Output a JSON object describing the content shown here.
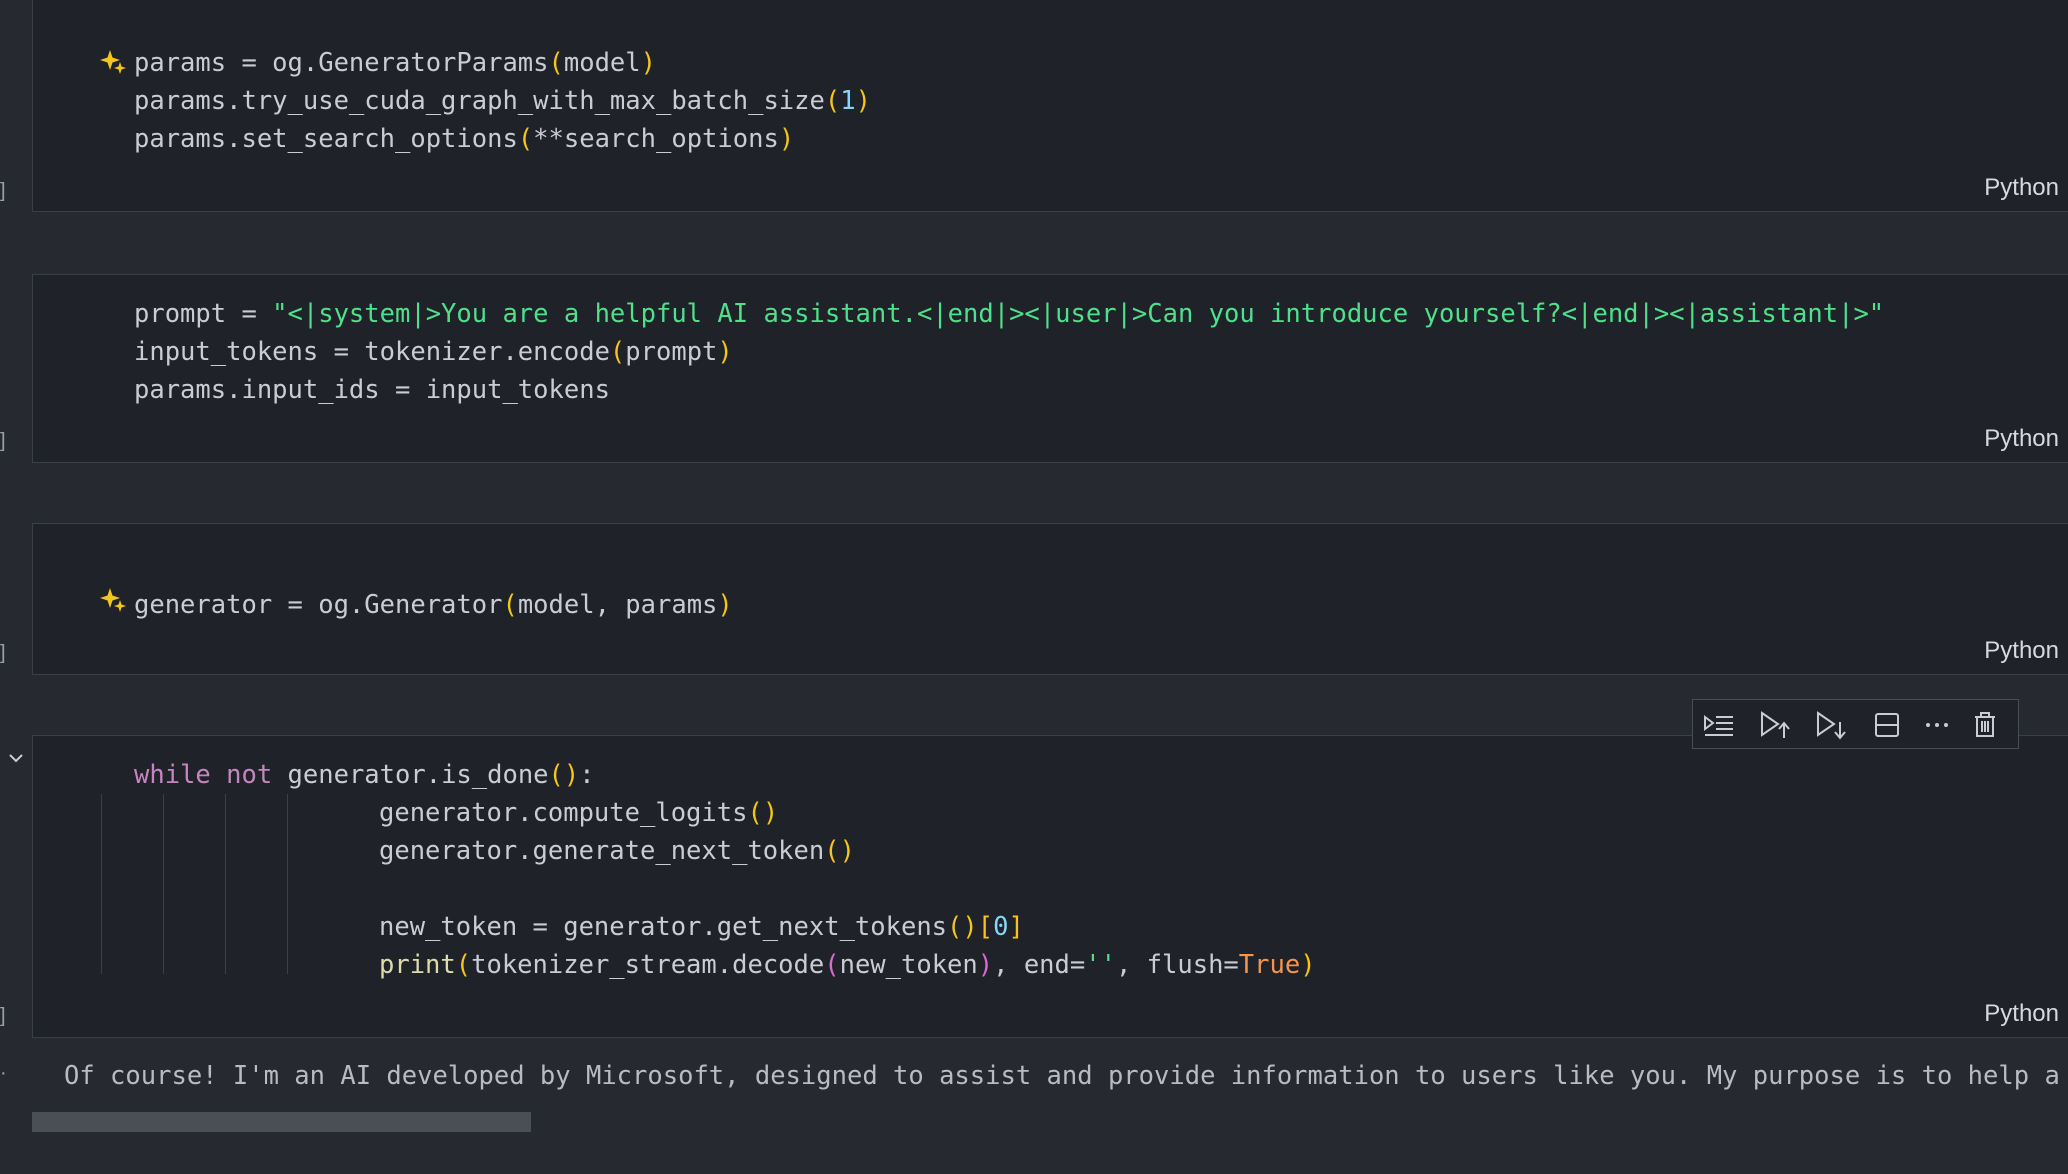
{
  "cells": [
    {
      "language": "Python",
      "lines": [
        "params = og.GeneratorParams(model)",
        "params.try_use_cuda_graph_with_max_batch_size(1)",
        "params.set_search_options(**search_options)"
      ]
    },
    {
      "language": "Python",
      "lines": [
        "prompt = \"<|system|>You are a helpful AI assistant.<|end|><|user|>Can you introduce yourself?<|end|><|assistant|>\"",
        "input_tokens = tokenizer.encode(prompt)",
        "params.input_ids = input_tokens"
      ]
    },
    {
      "language": "Python",
      "lines": [
        "generator = og.Generator(model, params)"
      ]
    },
    {
      "language": "Python",
      "lines": [
        "while not generator.is_done():",
        "generator.compute_logits()",
        "generator.generate_next_token()",
        "",
        "new_token = generator.get_next_tokens()[0]",
        "print(tokenizer_stream.decode(new_token), end='', flush=True)"
      ]
    }
  ],
  "output": {
    "text": "Of course! I'm an AI developed by Microsoft, designed to assist and provide information to users like you. My purpose is to help a"
  },
  "cell_toolbar": {
    "buttons": [
      "run-by-line-icon",
      "execute-above-icon",
      "execute-below-icon",
      "split-cell-icon",
      "more-actions-icon",
      "delete-cell-icon"
    ]
  },
  "colors": {
    "background": "#262a30",
    "cell_background": "#1f2228",
    "string": "#4ee08a",
    "keyword": "#c586c0",
    "bracket": "#f5c518",
    "number": "#86d6f5",
    "boolean": "#f5944d"
  }
}
